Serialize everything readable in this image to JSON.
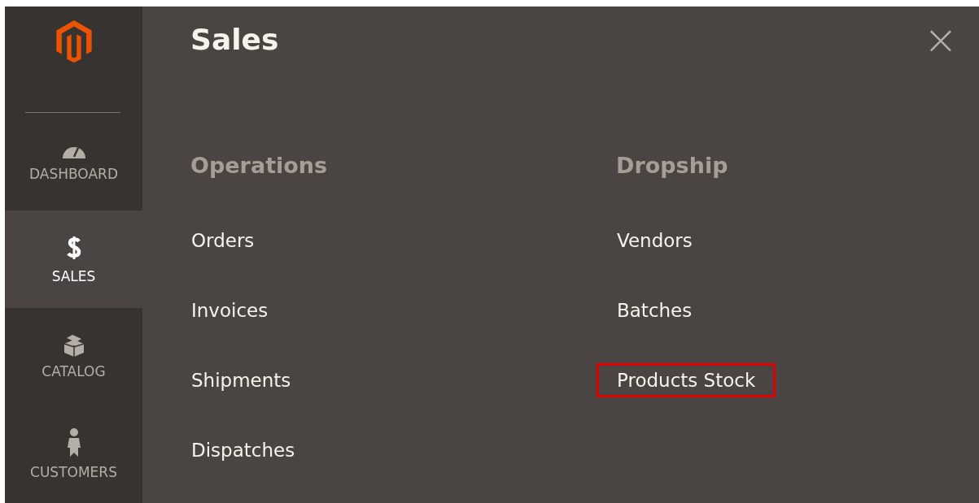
{
  "sidebar": {
    "items": [
      {
        "label": "DASHBOARD",
        "kind": "gauge",
        "selected": false
      },
      {
        "label": "SALES",
        "kind": "dollar",
        "selected": true
      },
      {
        "label": "CATALOG",
        "kind": "box",
        "selected": false
      },
      {
        "label": "CUSTOMERS",
        "kind": "person",
        "selected": false
      }
    ]
  },
  "panel": {
    "title": "Sales",
    "close_icon": "×",
    "columns": [
      {
        "heading": "Operations",
        "items": [
          {
            "label": "Orders",
            "highlighted": false
          },
          {
            "label": "Invoices",
            "highlighted": false
          },
          {
            "label": "Shipments",
            "highlighted": false
          },
          {
            "label": "Dispatches",
            "highlighted": false
          }
        ]
      },
      {
        "heading": "Dropship",
        "items": [
          {
            "label": "Vendors",
            "highlighted": false
          },
          {
            "label": "Batches",
            "highlighted": false
          },
          {
            "label": "Products Stock",
            "highlighted": true
          }
        ]
      }
    ]
  }
}
